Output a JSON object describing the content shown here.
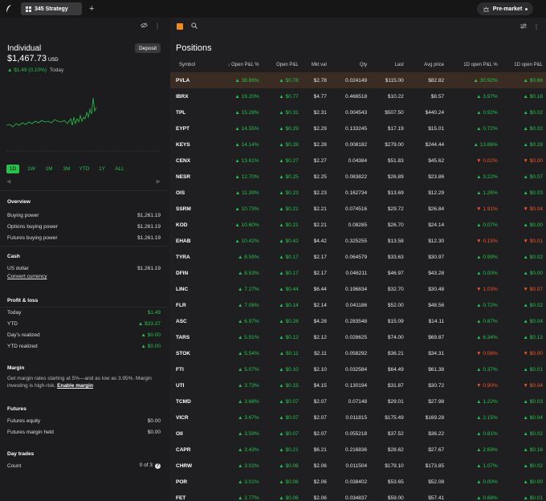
{
  "topbar": {
    "tab_label": "345 Strategy",
    "plus": "+",
    "premarket_label": "Pre-market"
  },
  "account": {
    "name": "Individual",
    "deposit_label": "Deposit",
    "balance": "$1,467.73",
    "currency": "USD",
    "today_change": "▲ $1.49 (0.10%)",
    "today_label": "Today"
  },
  "chart_ranges": [
    "1D",
    "1W",
    "1M",
    "3M",
    "YTD",
    "1Y",
    "ALL"
  ],
  "overview": {
    "title": "Overview",
    "rows": [
      {
        "label": "Buying power",
        "value": "$1,261.19"
      },
      {
        "label": "Options buying power",
        "value": "$1,261.19"
      },
      {
        "label": "Futures buying power",
        "value": "$1,261.19"
      }
    ]
  },
  "cash": {
    "title": "Cash",
    "label": "US dollar",
    "value": "$1,261.19",
    "link": "Convert currency"
  },
  "pnl": {
    "title": "Profit & loss",
    "rows": [
      {
        "label": "Today",
        "value": "$1.49"
      },
      {
        "label": "YTD",
        "value": "▲ $33.37"
      },
      {
        "label": "Day's realized",
        "value": "▲ $0.00"
      },
      {
        "label": "YTD realized",
        "value": "▲ $0.00"
      }
    ]
  },
  "margin": {
    "title": "Margin",
    "text": "Get margin rates starting at 5%—and as low as 3.95%. Margin investing is high-risk.",
    "link": "Enable margin"
  },
  "futures": {
    "title": "Futures",
    "rows": [
      {
        "label": "Futures equity",
        "value": "$0.00"
      },
      {
        "label": "Futures margin held",
        "value": "$0.00"
      }
    ]
  },
  "daytrades": {
    "title": "Day trades",
    "label": "Count",
    "value": "0 of 3"
  },
  "positions": {
    "title": "Positions",
    "columns": [
      "Symbol",
      "↓ Open P&L %",
      "Open P&L",
      "Mkt val",
      "Qty",
      "Last",
      "Avg price",
      "1D open P&L %",
      "1D open P&L"
    ],
    "rows": [
      [
        "PVLA",
        "▲ 38.86%",
        "▲ $0.78",
        "$2.78",
        "0.024149",
        "$115.00",
        "$82.82",
        "▲ 30.92%",
        "▲ $0.66"
      ],
      [
        "IBRX",
        "▲ 19.20%",
        "▲ $0.77",
        "$4.77",
        "0.466518",
        "$10.22",
        "$8.57",
        "▲ 3.97%",
        "▲ $0.18"
      ],
      [
        "TPL",
        "▲ 15.28%",
        "▲ $0.31",
        "$2.31",
        "0.004543",
        "$507.50",
        "$440.24",
        "▲ 0.92%",
        "▲ $0.02"
      ],
      [
        "EYPT",
        "▲ 14.55%",
        "▲ $0.29",
        "$2.29",
        "0.133245",
        "$17.19",
        "$15.01",
        "▲ 0.72%",
        "▲ $0.02"
      ],
      [
        "KEYS",
        "▲ 14.14%",
        "▲ $0.28",
        "$2.28",
        "0.008182",
        "$279.00",
        "$244.44",
        "▲ 13.86%",
        "▲ $0.28"
      ],
      [
        "CENX",
        "▲ 13.61%",
        "▲ $0.27",
        "$2.27",
        "0.04384",
        "$51.83",
        "$45.62",
        "▼ 0.02%",
        "▼ $0.00"
      ],
      [
        "NESR",
        "▲ 12.70%",
        "▲ $0.25",
        "$2.25",
        "0.083822",
        "$26.89",
        "$23.86",
        "▲ 3.22%",
        "▲ $0.07"
      ],
      [
        "OIS",
        "▲ 11.39%",
        "▲ $0.23",
        "$2.23",
        "0.162734",
        "$13.69",
        "$12.29",
        "▲ 1.26%",
        "▲ $0.03"
      ],
      [
        "SSRM",
        "▲ 10.73%",
        "▲ $0.21",
        "$2.21",
        "0.074516",
        "$29.72",
        "$26.84",
        "▼ 1.91%",
        "▼ $0.04"
      ],
      [
        "KOD",
        "▲ 10.60%",
        "▲ $0.21",
        "$2.21",
        "0.08285",
        "$26.70",
        "$24.14",
        "▲ 0.07%",
        "▲ $0.00"
      ],
      [
        "EHAB",
        "▲ 10.42%",
        "▲ $0.42",
        "$4.42",
        "0.325255",
        "$13.58",
        "$12.30",
        "▼ 0.15%",
        "▼ $0.01"
      ],
      [
        "TYRA",
        "▲ 8.59%",
        "▲ $0.17",
        "$2.17",
        "0.064579",
        "$33.63",
        "$30.97",
        "▲ 0.99%",
        "▲ $0.02"
      ],
      [
        "DFIN",
        "▲ 8.53%",
        "▲ $0.17",
        "$2.17",
        "0.046211",
        "$46.97",
        "$43.28",
        "▲ 0.00%",
        "▲ $0.00"
      ],
      [
        "LINC",
        "▲ 7.27%",
        "▲ $0.44",
        "$6.44",
        "0.196834",
        "$32.70",
        "$30.48",
        "▼ 1.03%",
        "▼ $0.07"
      ],
      [
        "FLR",
        "▲ 7.08%",
        "▲ $0.14",
        "$2.14",
        "0.041186",
        "$52.00",
        "$48.56",
        "▲ 0.72%",
        "▲ $0.02"
      ],
      [
        "ASC",
        "▲ 6.97%",
        "▲ $0.28",
        "$4.28",
        "0.283548",
        "$15.09",
        "$14.11",
        "▲ 0.87%",
        "▲ $0.04"
      ],
      [
        "TARS",
        "▲ 5.91%",
        "▲ $0.12",
        "$2.12",
        "0.028625",
        "$74.00",
        "$69.87",
        "▲ 6.34%",
        "▲ $0.13"
      ],
      [
        "STOK",
        "▲ 5.54%",
        "▲ $0.11",
        "$2.11",
        "0.058292",
        "$36.21",
        "$34.31",
        "▼ 0.06%",
        "▼ $0.00"
      ],
      [
        "FTI",
        "▲ 5.07%",
        "▲ $0.10",
        "$2.10",
        "0.032584",
        "$64.49",
        "$61.38",
        "▲ 0.37%",
        "▲ $0.01"
      ],
      [
        "UTI",
        "▲ 3.73%",
        "▲ $0.15",
        "$4.15",
        "0.130194",
        "$31.87",
        "$30.72",
        "▼ 0.90%",
        "▼ $0.04"
      ],
      [
        "TCMD",
        "▲ 3.68%",
        "▲ $0.07",
        "$2.07",
        "0.07148",
        "$29.01",
        "$27.98",
        "▲ 1.22%",
        "▲ $0.03"
      ],
      [
        "VICR",
        "▲ 3.67%",
        "▲ $0.07",
        "$2.07",
        "0.011815",
        "$175.49",
        "$169.28",
        "▲ 2.15%",
        "▲ $0.04"
      ],
      [
        "OII",
        "▲ 3.59%",
        "▲ $0.07",
        "$2.07",
        "0.055218",
        "$37.52",
        "$36.22",
        "▲ 0.81%",
        "▲ $0.02"
      ],
      [
        "CAPR",
        "▲ 3.43%",
        "▲ $0.21",
        "$6.21",
        "0.216836",
        "$28.62",
        "$27.67",
        "▲ 2.69%",
        "▲ $0.16"
      ],
      [
        "CHRW",
        "▲ 3.02%",
        "▲ $0.06",
        "$2.06",
        "0.011504",
        "$179.10",
        "$173.85",
        "▲ 1.07%",
        "▲ $0.02"
      ],
      [
        "POR",
        "▲ 3.01%",
        "▲ $0.06",
        "$2.06",
        "0.038402",
        "$53.65",
        "$52.08",
        "▲ 0.00%",
        "▲ $0.00"
      ],
      [
        "FET",
        "▲ 2.77%",
        "▲ $0.06",
        "$2.06",
        "0.034837",
        "$59.00",
        "$57.41",
        "▲ 0.68%",
        "▲ $0.01"
      ]
    ]
  },
  "colors": {
    "up": "#27c24c",
    "down": "#f0562a",
    "accent": "#f08c1a"
  }
}
